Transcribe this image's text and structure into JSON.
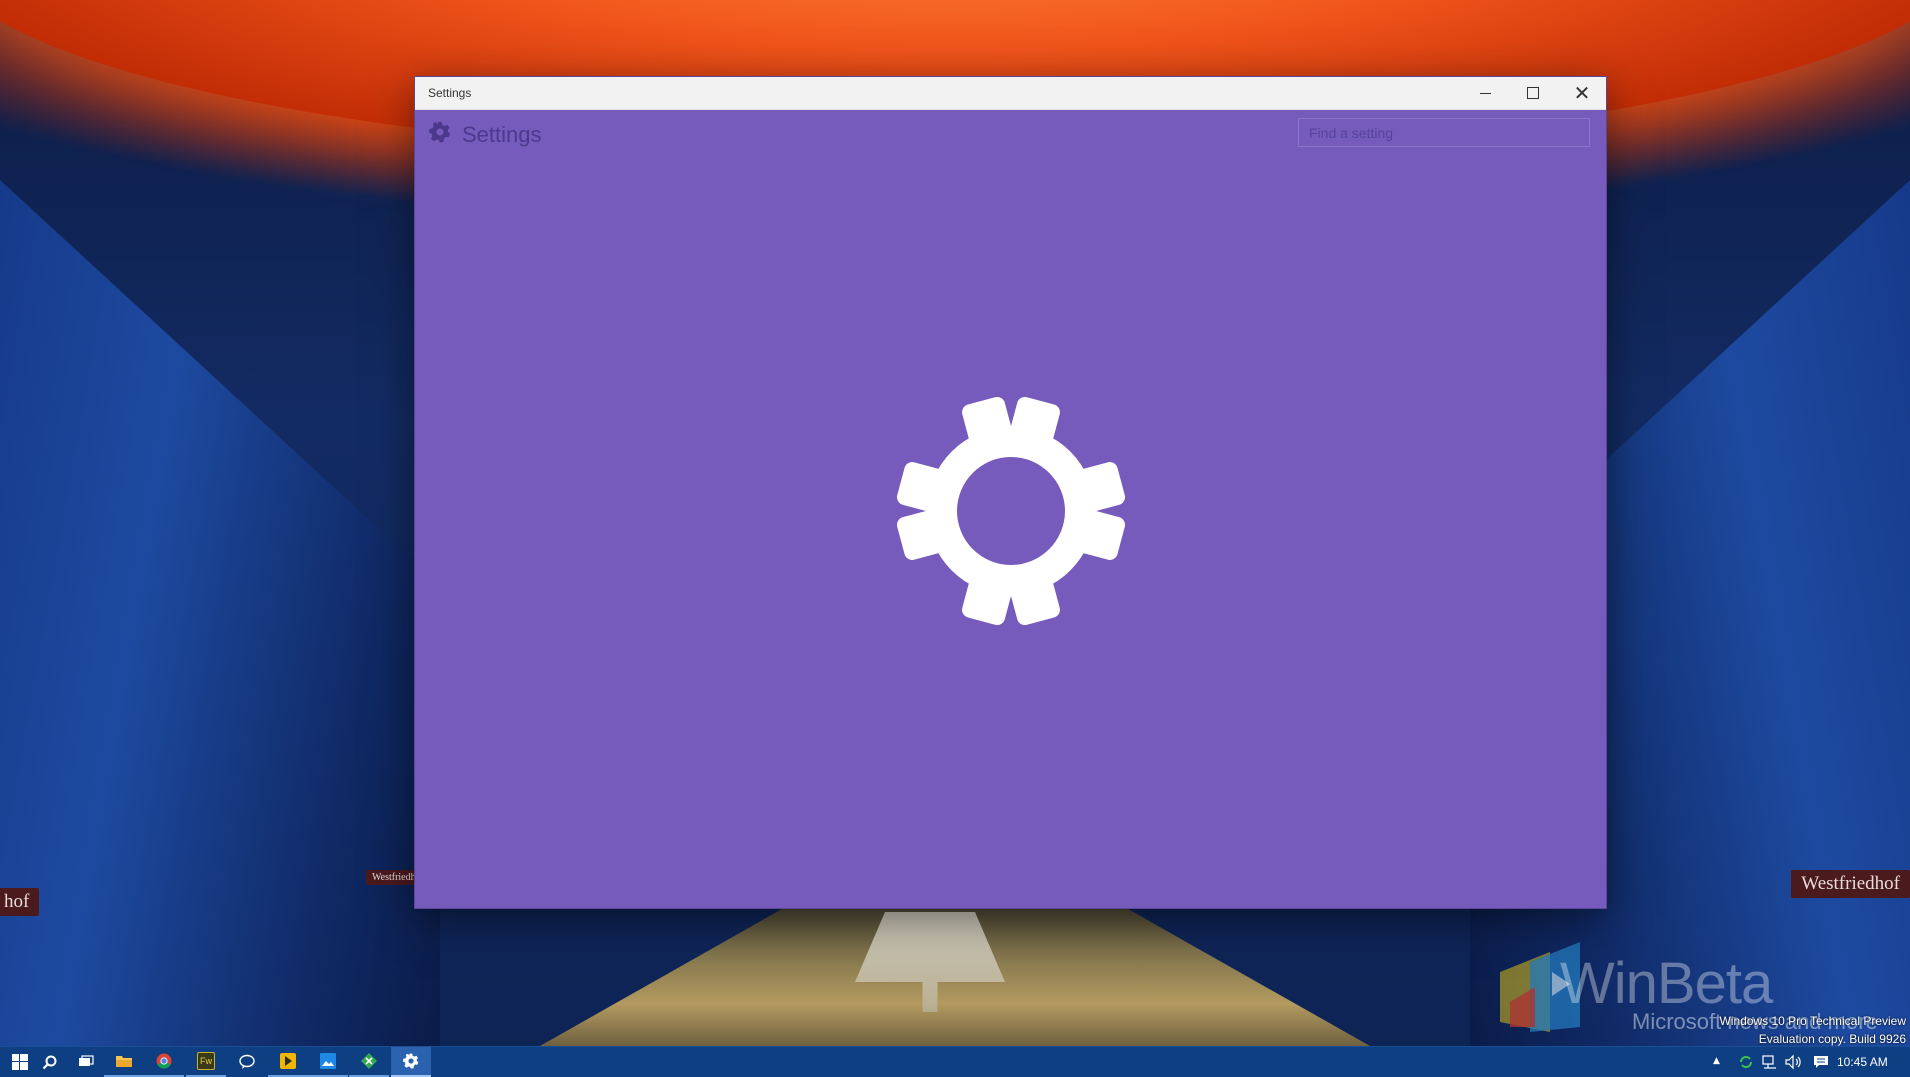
{
  "window": {
    "title": "Settings",
    "minimize_icon": "minimize-icon",
    "maximize_icon": "maximize-icon",
    "close_glyph": "✕"
  },
  "app": {
    "title": "Settings",
    "search_placeholder": "Find a setting",
    "accent_color": "#765bbc",
    "header_icon": "gear-icon",
    "splash_icon": "gear-icon"
  },
  "desktop": {
    "sign_left": "hof",
    "sign_mid": "Westfriedhof",
    "sign_right": "Westfriedhof",
    "watermark_brand": "WinBeta",
    "watermark_brand_sub": "Microsoft news and more",
    "eval_line1": "Windows 10 Pro Technical Preview",
    "eval_line2": "Evaluation copy. Build 9926"
  },
  "taskbar": {
    "color": "#0e3f82",
    "items": [
      {
        "name": "start",
        "icon": "windows-logo-icon"
      },
      {
        "name": "search",
        "icon": "search-icon"
      },
      {
        "name": "task-view",
        "icon": "task-view-icon"
      },
      {
        "name": "file-explorer",
        "icon": "folder-icon"
      },
      {
        "name": "chrome",
        "icon": "chrome-icon"
      },
      {
        "name": "fireworks",
        "icon": "fireworks-icon",
        "label": "Fw"
      },
      {
        "name": "messaging",
        "icon": "chat-icon"
      },
      {
        "name": "media",
        "icon": "media-icon"
      },
      {
        "name": "photos",
        "icon": "photos-icon"
      },
      {
        "name": "xbox",
        "icon": "xbox-icon"
      },
      {
        "name": "settings",
        "icon": "gear-icon"
      }
    ],
    "tray": {
      "show_hidden_glyph": "▲",
      "clock": "10:45 AM"
    }
  }
}
